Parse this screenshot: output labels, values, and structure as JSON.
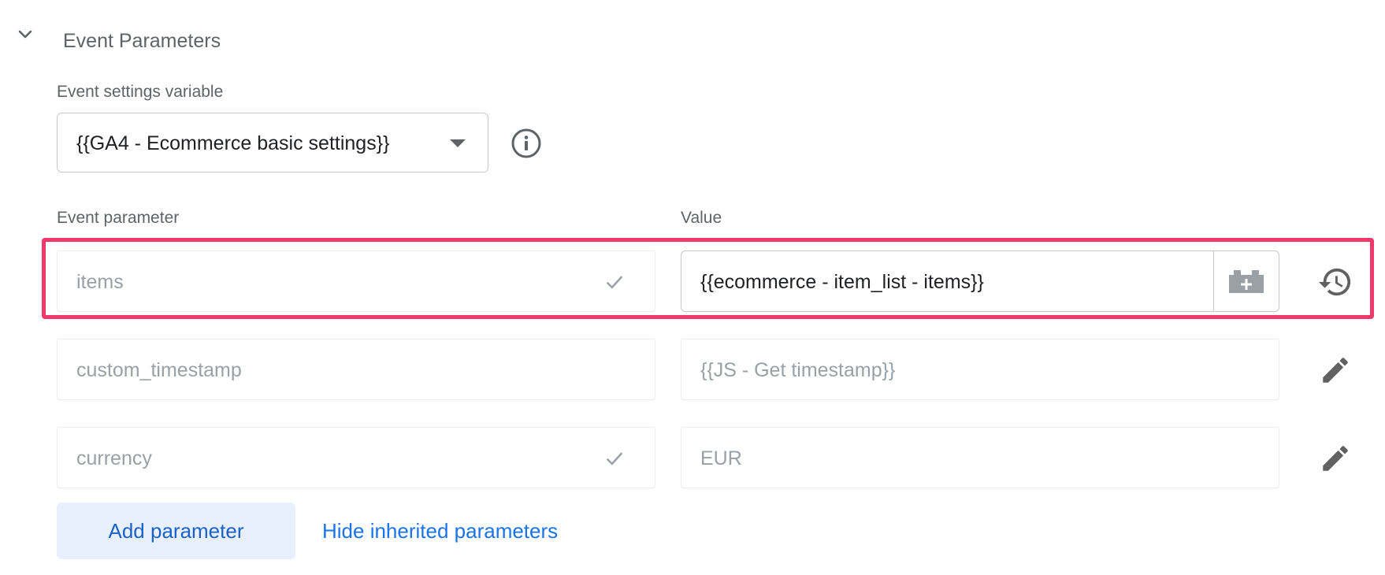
{
  "section": {
    "title": "Event Parameters"
  },
  "settings": {
    "label": "Event settings variable",
    "selected_value": "{{GA4 - Ecommerce basic settings}}"
  },
  "columns": {
    "param_header": "Event parameter",
    "value_header": "Value"
  },
  "rows": [
    {
      "param": "items",
      "value": "{{ecommerce - item_list - items}}",
      "inherited_check": true,
      "action_icon": "history-icon",
      "active": true
    },
    {
      "param": "custom_timestamp",
      "value": "{{JS - Get timestamp}}",
      "inherited_check": false,
      "action_icon": "pencil-icon",
      "active": false
    },
    {
      "param": "currency",
      "value": "EUR",
      "inherited_check": true,
      "action_icon": "pencil-icon",
      "active": false
    }
  ],
  "actions": {
    "add_label": "Add parameter",
    "hide_inherited_label": "Hide inherited parameters"
  },
  "colors": {
    "highlight": "#f0386b",
    "link": "#1a73e8",
    "button_bg": "#e8f0fe"
  }
}
